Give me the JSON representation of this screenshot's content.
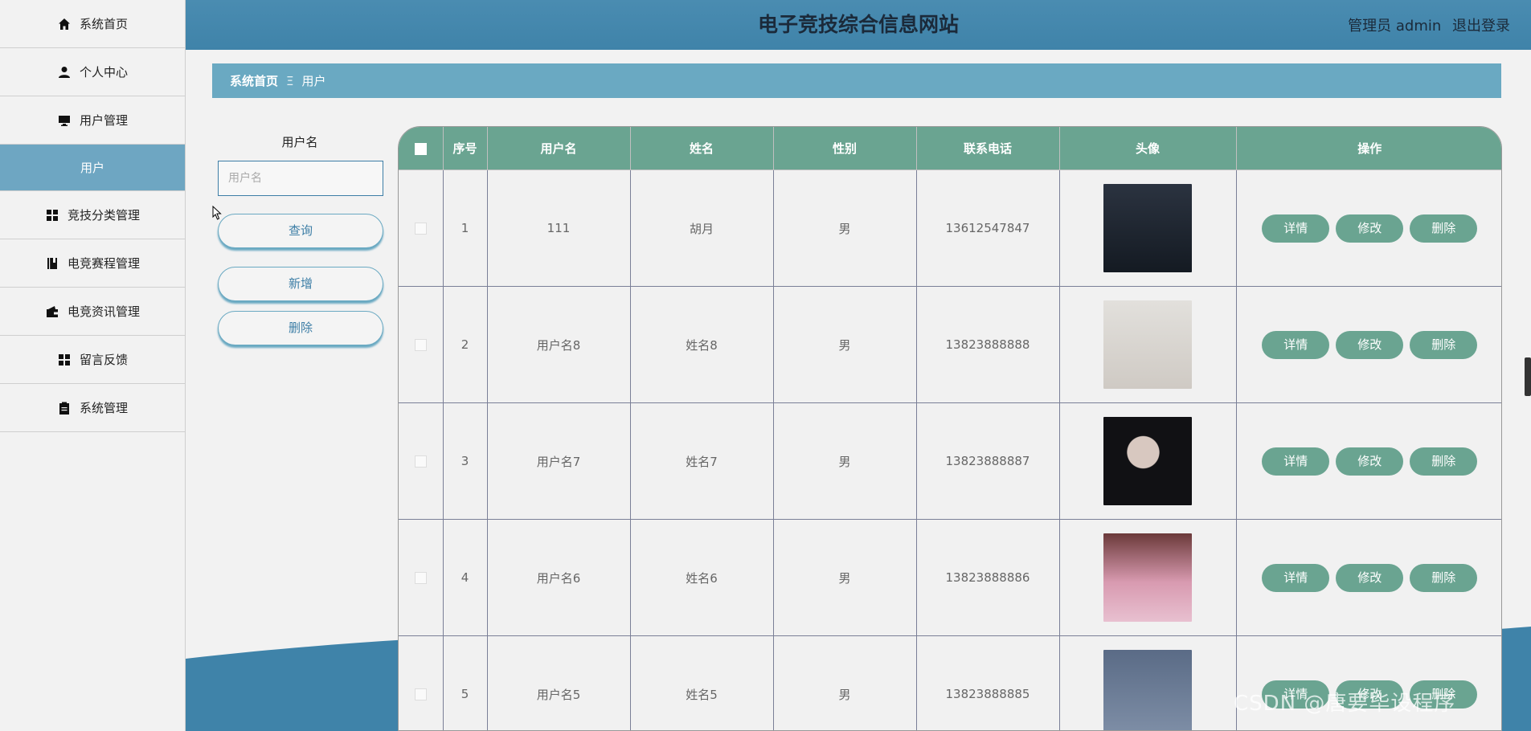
{
  "header": {
    "title": "电子竞技综合信息网站",
    "user_label": "管理员 admin",
    "logout_label": "退出登录"
  },
  "sidebar": {
    "items": [
      {
        "label": "系统首页",
        "icon": "home-icon"
      },
      {
        "label": "个人中心",
        "icon": "person-icon"
      },
      {
        "label": "用户管理",
        "icon": "monitor-icon"
      },
      {
        "label": "用户",
        "icon": "",
        "sub": true
      },
      {
        "label": "竞技分类管理",
        "icon": "grid-icon"
      },
      {
        "label": "电竞赛程管理",
        "icon": "book-icon"
      },
      {
        "label": "电竞资讯管理",
        "icon": "wallet-icon"
      },
      {
        "label": "留言反馈",
        "icon": "grid-icon"
      },
      {
        "label": "系统管理",
        "icon": "clipboard-icon"
      }
    ]
  },
  "breadcrumb": {
    "home": "系统首页",
    "separator": "Ξ",
    "current": "用户"
  },
  "search": {
    "label": "用户名",
    "placeholder": "用户名",
    "query_button": "查询",
    "add_button": "新增",
    "delete_button": "删除"
  },
  "table": {
    "columns": [
      "序号",
      "用户名",
      "姓名",
      "性别",
      "联系电话",
      "头像",
      "操作"
    ],
    "rows": [
      {
        "index": "1",
        "username": "111",
        "name": "胡月",
        "gender": "男",
        "phone": "13612547847",
        "avatar_color": "#1d2430"
      },
      {
        "index": "2",
        "username": "用户名8",
        "name": "姓名8",
        "gender": "男",
        "phone": "13823888888",
        "avatar_color": "#d9d6d2"
      },
      {
        "index": "3",
        "username": "用户名7",
        "name": "姓名7",
        "gender": "男",
        "phone": "13823888887",
        "avatar_color": "#111114"
      },
      {
        "index": "4",
        "username": "用户名6",
        "name": "姓名6",
        "gender": "男",
        "phone": "13823888886",
        "avatar_color": "#c98aa0"
      },
      {
        "index": "5",
        "username": "用户名5",
        "name": "姓名5",
        "gender": "男",
        "phone": "13823888885",
        "avatar_color": "#5a6b86"
      }
    ],
    "actions": {
      "detail": "详情",
      "edit": "修改",
      "delete": "删除"
    }
  },
  "watermark": "CSDN @唐要毕设程序",
  "colors": {
    "header": "#4a8cb1",
    "breadcrumb": "#6aa9c2",
    "table_header": "#6aa491",
    "action_button": "#6aa491",
    "sidebar_active": "#6ea6c2"
  }
}
